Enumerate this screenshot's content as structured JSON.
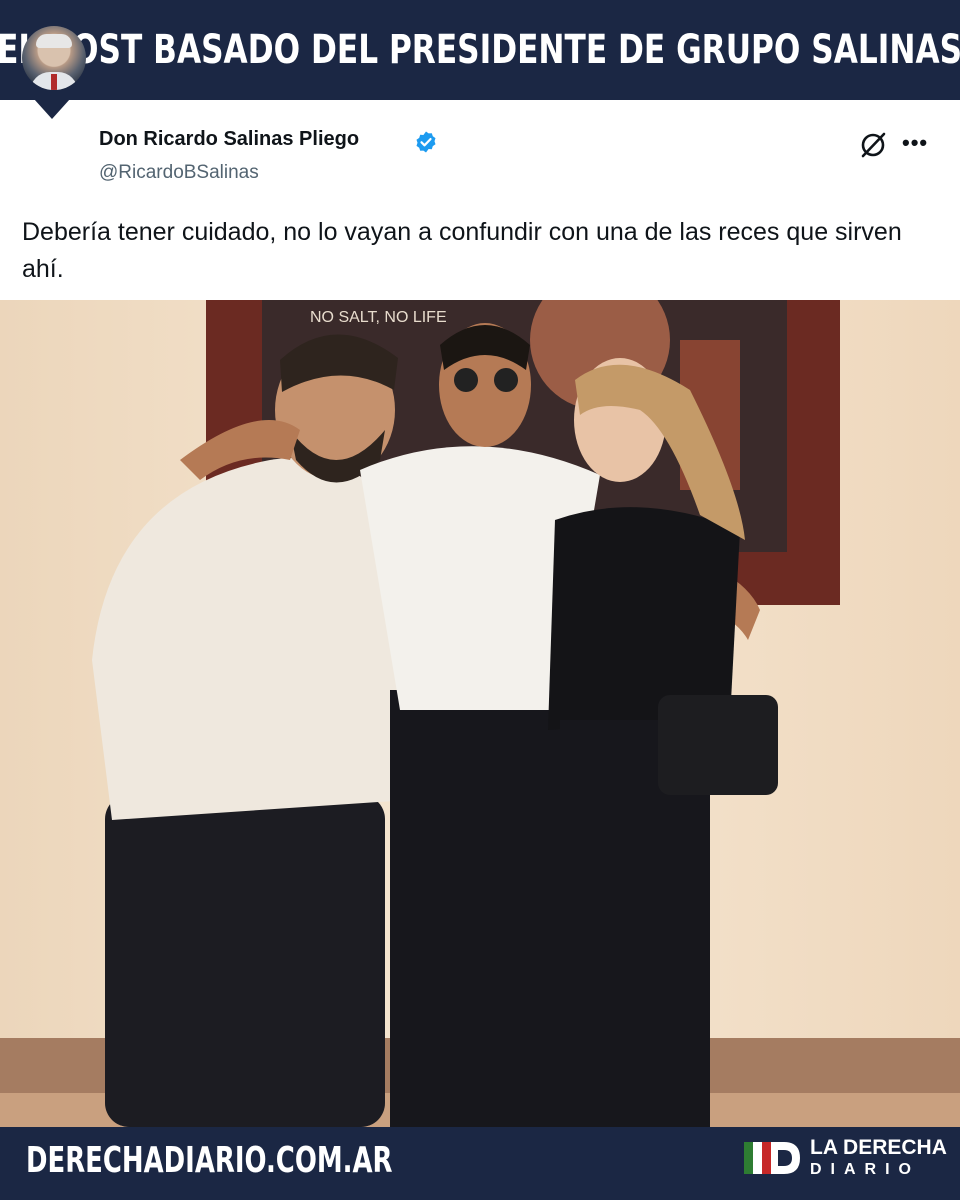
{
  "header": {
    "headline": "EL POST BASADO DEL PRESIDENTE DE GRUPO SALINAS"
  },
  "tweet": {
    "author_name": "Don Ricardo Salinas Pliego",
    "author_handle": "@RicardoBSalinas",
    "verified_icon": "verified-badge-icon",
    "action_icons": [
      "grok-icon",
      "more-horizontal-icon"
    ],
    "more_label": "•••",
    "text": "Debería tener cuidado, no lo vayan a confundir con una de las reces que sirven ahí."
  },
  "footer": {
    "site_url": "DERECHADIARIO.COM.AR",
    "logo_title": "LA DERECHA",
    "logo_subtitle": "DIARIO"
  },
  "colors": {
    "brand_navy": "#1b2744",
    "verified_blue": "#1d9bf0",
    "handle_gray": "#536471"
  }
}
